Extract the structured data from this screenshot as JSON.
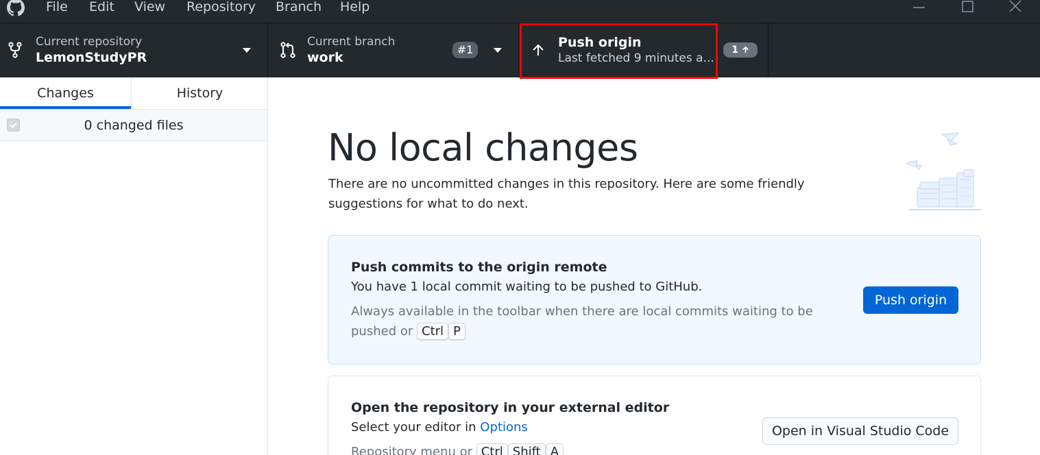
{
  "menu": {
    "file": "File",
    "edit": "Edit",
    "view": "View",
    "repository": "Repository",
    "branch": "Branch",
    "help": "Help"
  },
  "toolbar": {
    "repo_label": "Current repository",
    "repo_name": "LemonStudyPR",
    "branch_label": "Current branch",
    "branch_name": "work",
    "pr_badge": "#1",
    "push_title": "Push origin",
    "push_subtitle": "Last fetched 9 minutes a...",
    "push_count": "1"
  },
  "sidebar": {
    "tabs": [
      {
        "label": "Changes",
        "selected": true
      },
      {
        "label": "History",
        "selected": false
      }
    ],
    "changed_files": "0 changed files"
  },
  "main": {
    "title": "No local changes",
    "description": "There are no uncommitted changes in this repository. Here are some friendly suggestions for what to do next.",
    "push_card": {
      "title": "Push commits to the origin remote",
      "line": "You have 1 local commit waiting to be pushed to GitHub.",
      "hint_prefix": "Always available in the toolbar when there are local commits waiting to be pushed or",
      "shortcut": [
        "Ctrl",
        "P"
      ],
      "button": "Push origin"
    },
    "editor_card": {
      "title": "Open the repository in your external editor",
      "line_prefix": "Select your editor in",
      "line_link": "Options",
      "hint_prefix": "Repository menu or",
      "shortcut": [
        "Ctrl",
        "Shift",
        "A"
      ],
      "button": "Open in Visual Studio Code"
    }
  },
  "colors": {
    "toolbar_bg": "#24292e",
    "accent": "#0366d6",
    "highlight": "#ff0000",
    "card_blue_bg": "#f1f8ff"
  }
}
